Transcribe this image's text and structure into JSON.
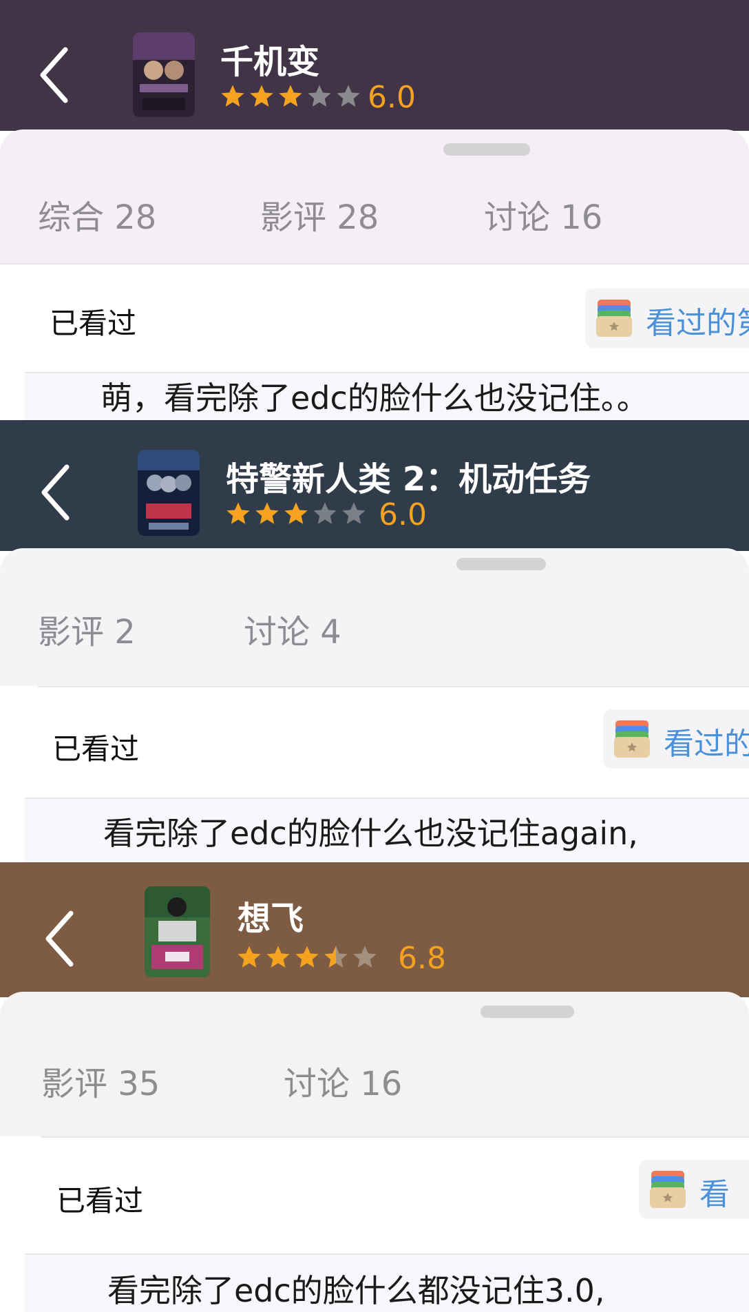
{
  "colors": {
    "header_1": "#413446",
    "sheet_1": "#f4eff4",
    "header_2": "#313c4a",
    "sheet_2": "#f3f4f6",
    "header_3": "#7e5b43",
    "sheet_3": "#f5f3f1",
    "star_filled": "#f4a21f",
    "star_empty": "#8a8a8e",
    "link_blue": "#4b91d9"
  },
  "blocks": [
    {
      "title": "千机变",
      "rating": "6.0",
      "stars_filled": 3,
      "tabs": [
        "综合 28",
        "影评 28",
        "讨论 16"
      ],
      "watched_label": "已看过",
      "chip_label": "看过的第",
      "comment": "萌，看完除了edc的脸什么也没记住。。",
      "icons": [
        "back-chevron-icon",
        "card-stack-icon"
      ]
    },
    {
      "title": "特警新人类 2：机动任务",
      "rating": "6.0",
      "stars_filled": 3,
      "tabs": [
        "影评 2",
        "讨论 4"
      ],
      "watched_label": "已看过",
      "chip_label": "看过的",
      "comment": "看完除了edc的脸什么也没记住again,",
      "icons": [
        "back-chevron-icon",
        "card-stack-icon"
      ]
    },
    {
      "title": "想飞",
      "rating": "6.8",
      "stars_filled": 3.5,
      "tabs": [
        "影评 35",
        "讨论 16"
      ],
      "watched_label": "已看过",
      "chip_label": "看",
      "comment": "看完除了edc的脸什么都没记住3.0,",
      "icons": [
        "back-chevron-icon",
        "card-stack-icon"
      ]
    }
  ]
}
